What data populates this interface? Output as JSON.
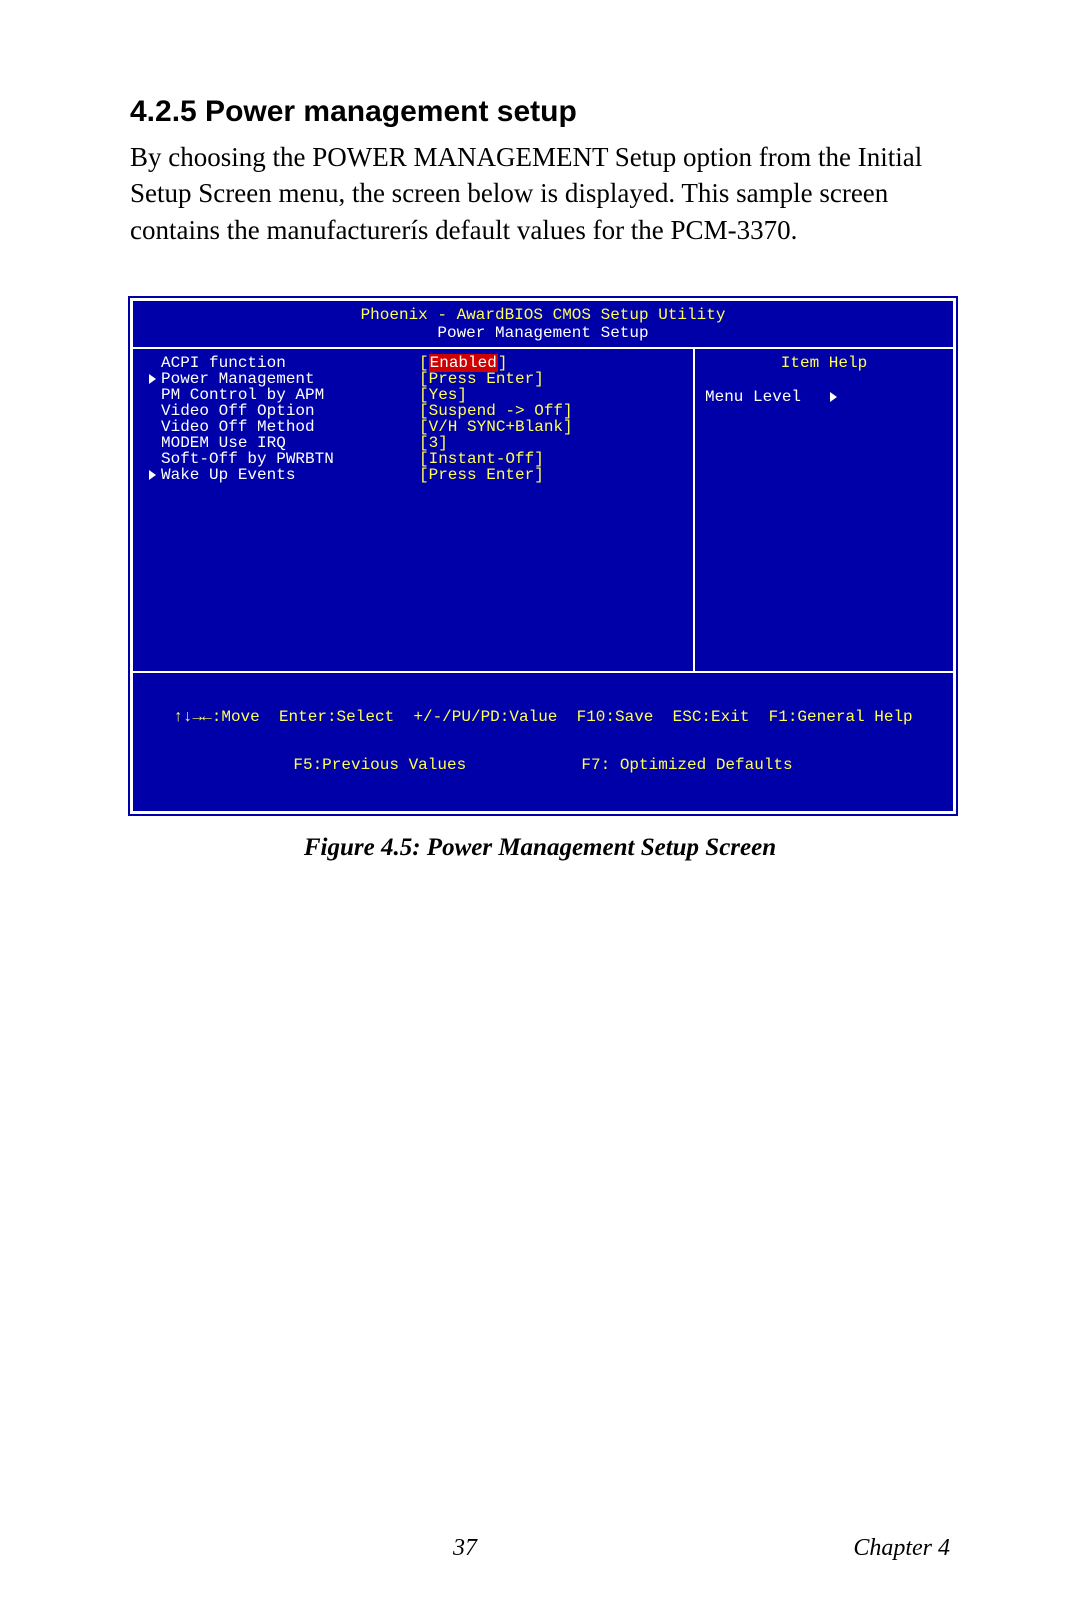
{
  "heading": "4.2.5 Power management setup",
  "intro": "By choosing the POWER MANAGEMENT Setup option from the Initial Setup Screen menu, the screen below is displayed. This sample screen contains the manufacturerís default values for the PCM-3370.",
  "bios": {
    "title": "Phoenix - AwardBIOS CMOS Setup Utility",
    "subtitle": "Power Management Setup",
    "items": [
      {
        "marker": "",
        "label": "ACPI function",
        "value": "[Enabled]",
        "selected": true
      },
      {
        "marker": "►",
        "label": "Power Management",
        "value": "[Press Enter]",
        "selected": false
      },
      {
        "marker": "",
        "label": "PM Control by APM",
        "value": "[Yes]",
        "selected": false
      },
      {
        "marker": "",
        "label": "Video Off Option",
        "value": "[Suspend -> Off]",
        "selected": false
      },
      {
        "marker": "",
        "label": "Video Off Method",
        "value": "[V/H SYNC+Blank]",
        "selected": false
      },
      {
        "marker": "",
        "label": "MODEM Use IRQ",
        "value": "[3]",
        "selected": false
      },
      {
        "marker": "",
        "label": "Soft-Off by PWRBTN",
        "value": "[Instant-Off]",
        "selected": false
      },
      {
        "marker": "►",
        "label": "Wake Up Events",
        "value": "[Press Enter]",
        "selected": false
      }
    ],
    "help_title": "Item Help",
    "help_menu_level": "Menu Level   ",
    "footer_line1": "↑↓→←:Move  Enter:Select  +/-/PU/PD:Value  F10:Save  ESC:Exit  F1:General Help",
    "footer_line2": "F5:Previous Values            F7: Optimized Defaults"
  },
  "figure_caption": "Figure 4.5: Power Management Setup Screen",
  "page_number": "37",
  "chapter_label": "Chapter 4"
}
